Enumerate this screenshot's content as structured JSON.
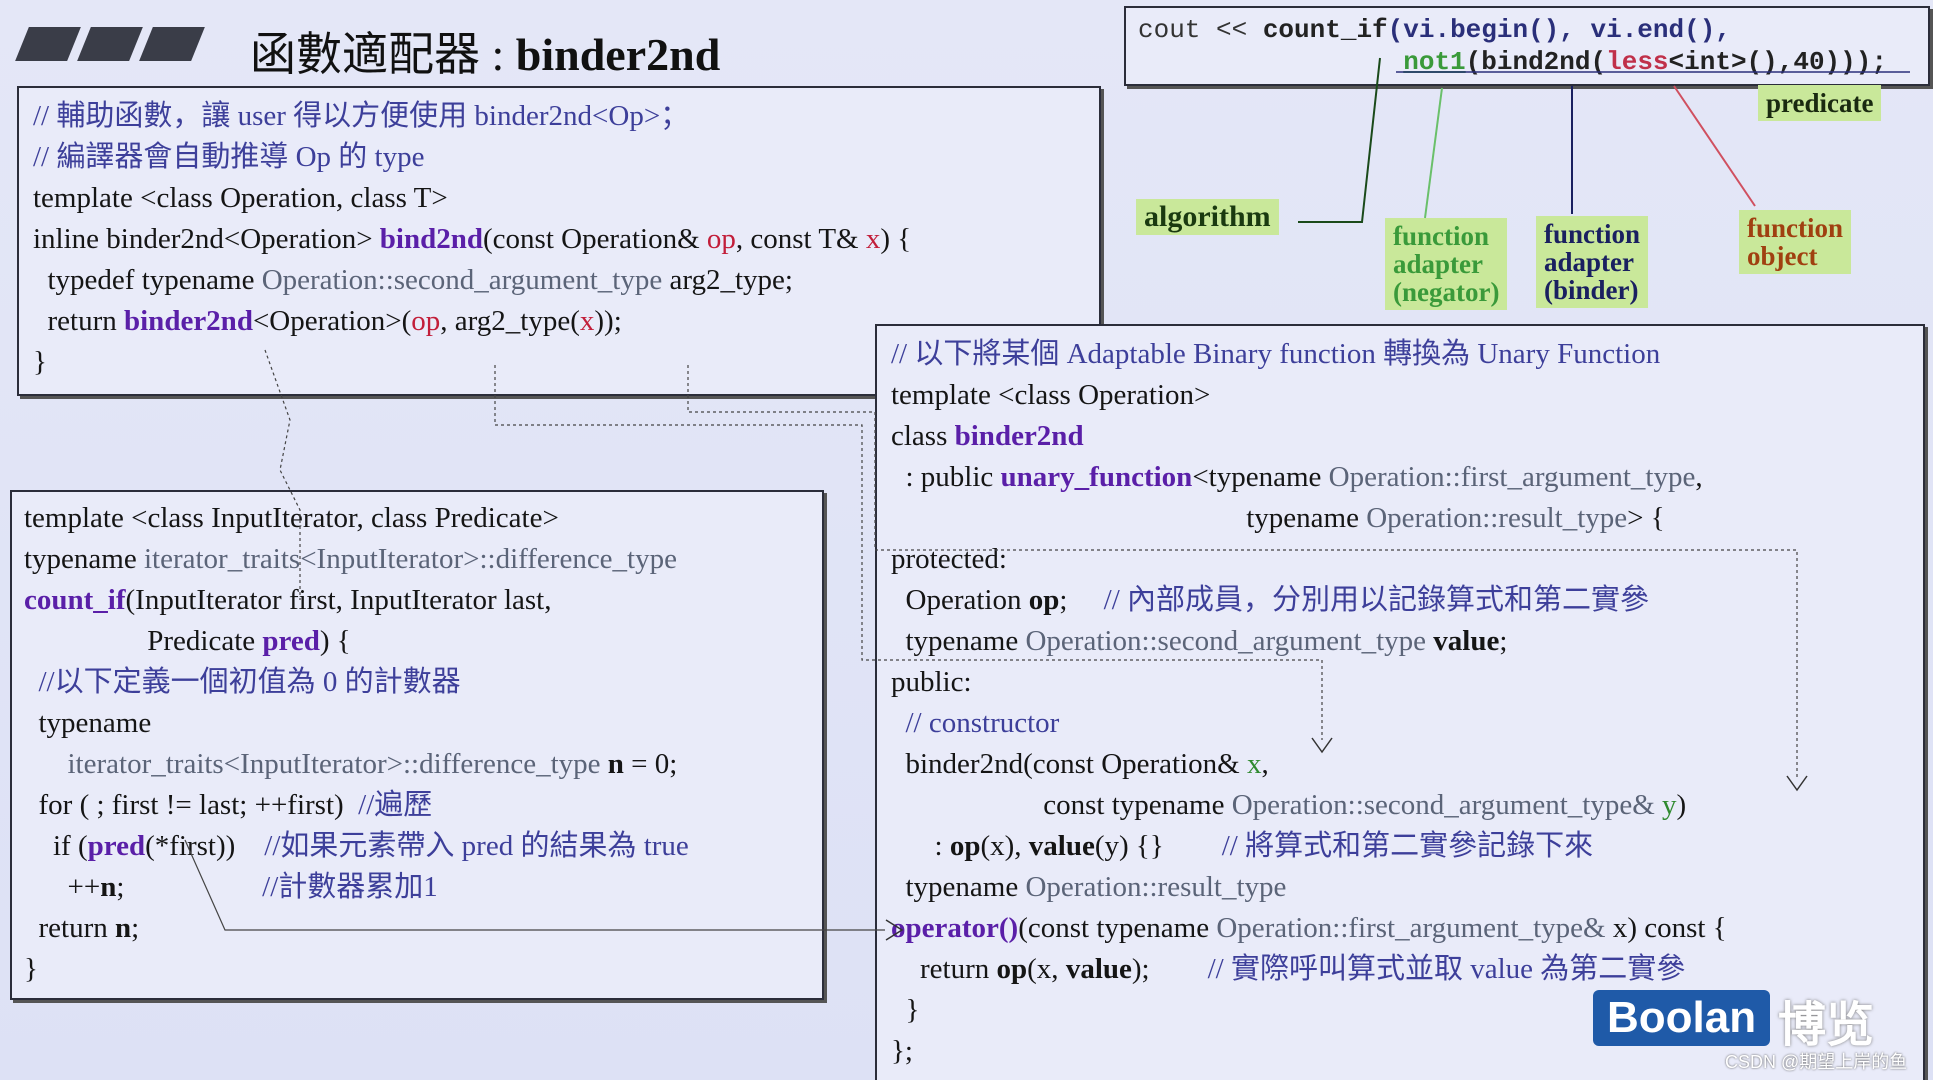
{
  "title": {
    "cn": "函數適配器 : ",
    "en": "binder2nd"
  },
  "top_code": [
    [
      {
        "t": "cout << ",
        "c": "m-plain"
      },
      {
        "t": "count_if",
        "c": "m-dark"
      },
      {
        "t": "(vi.begin(), vi.end(),",
        "c": "m-blue"
      }
    ],
    [
      {
        "t": "                 ",
        "c": "m-plain"
      },
      {
        "t": "not1",
        "c": "m-green"
      },
      {
        "t": "(bind2nd(",
        "c": "m-dark"
      },
      {
        "t": "less",
        "c": "m-red"
      },
      {
        "t": "<int>(),40)));",
        "c": "m-dark"
      }
    ]
  ],
  "labels": {
    "predicate": "predicate",
    "algorithm": "algorithm",
    "negator": "function\nadapter\n(negator)",
    "binder": "function\nadapter\n(binder)",
    "function_object": "function\nobject"
  },
  "colors": {
    "negator": "#3a9a3a",
    "binder": "#1a2060",
    "function_object": "#a04010",
    "algorithm": "#1a3a10",
    "keyword": "#5a1fa8"
  },
  "box1": [
    [
      {
        "t": "// 輔助函數，讓 user 得以方便使用 binder2nd<Op>；",
        "c": "cm"
      }
    ],
    [
      {
        "t": "// 編譯器會自動推導 Op 的 type",
        "c": "cm"
      }
    ],
    [
      {
        "t": "template <class Operation, class T>",
        "c": ""
      }
    ],
    [
      {
        "t": "inline binder2nd<Operation> ",
        "c": ""
      },
      {
        "t": "bind2nd",
        "c": "kw"
      },
      {
        "t": "(const Operation& ",
        "c": ""
      },
      {
        "t": "op",
        "c": "red"
      },
      {
        "t": ", const T& ",
        "c": ""
      },
      {
        "t": "x",
        "c": "red"
      },
      {
        "t": ") {",
        "c": ""
      }
    ],
    [
      {
        "t": "  typedef typename ",
        "c": ""
      },
      {
        "t": "Operation::second_argument_type",
        "c": "gray"
      },
      {
        "t": " arg2_type;",
        "c": ""
      }
    ],
    [
      {
        "t": "  return ",
        "c": ""
      },
      {
        "t": "binder2nd",
        "c": "kw"
      },
      {
        "t": "<Operation>(",
        "c": ""
      },
      {
        "t": "op",
        "c": "red"
      },
      {
        "t": ", arg2_type(",
        "c": ""
      },
      {
        "t": "x",
        "c": "red"
      },
      {
        "t": "));",
        "c": ""
      }
    ],
    [
      {
        "t": "}",
        "c": ""
      }
    ]
  ],
  "box2": [
    [
      {
        "t": "template <class InputIterator, class Predicate>",
        "c": ""
      }
    ],
    [
      {
        "t": "typename ",
        "c": ""
      },
      {
        "t": "iterator_traits<InputIterator>::difference_type",
        "c": "gray"
      }
    ],
    [
      {
        "t": "count_if",
        "c": "kw"
      },
      {
        "t": "(InputIterator first, InputIterator last,",
        "c": ""
      }
    ],
    [
      {
        "t": "                 Predicate ",
        "c": ""
      },
      {
        "t": "pred",
        "c": "kw"
      },
      {
        "t": ") {",
        "c": ""
      }
    ],
    [
      {
        "t": "  //以下定義一個初值為 0 的計數器",
        "c": "cm"
      }
    ],
    [
      {
        "t": "  typename",
        "c": ""
      }
    ],
    [
      {
        "t": "      ",
        "c": ""
      },
      {
        "t": "iterator_traits<InputIterator>::difference_type ",
        "c": "gray"
      },
      {
        "t": "n",
        "c": "bold"
      },
      {
        "t": " = 0;",
        "c": ""
      }
    ],
    [
      {
        "t": "  for ( ; first != last; ++first)  ",
        "c": ""
      },
      {
        "t": "//遍歷",
        "c": "cm"
      }
    ],
    [
      {
        "t": "    if (",
        "c": ""
      },
      {
        "t": "pred",
        "c": "kw"
      },
      {
        "t": "(*first))    ",
        "c": ""
      },
      {
        "t": "//如果元素帶入 pred 的結果為 true",
        "c": "cm"
      }
    ],
    [
      {
        "t": "      ++",
        "c": ""
      },
      {
        "t": "n",
        "c": "bold"
      },
      {
        "t": ";                   ",
        "c": ""
      },
      {
        "t": "//計數器累加1",
        "c": "cm"
      }
    ],
    [
      {
        "t": "  return ",
        "c": ""
      },
      {
        "t": "n",
        "c": "bold"
      },
      {
        "t": ";",
        "c": ""
      }
    ],
    [
      {
        "t": "}",
        "c": ""
      }
    ]
  ],
  "box3": [
    [
      {
        "t": "// 以下將某個 Adaptable Binary function 轉換為 Unary Function",
        "c": "cm"
      }
    ],
    [
      {
        "t": "template <class Operation>",
        "c": ""
      }
    ],
    [
      {
        "t": "class ",
        "c": ""
      },
      {
        "t": "binder2nd",
        "c": "kw"
      }
    ],
    [
      {
        "t": "  : public ",
        "c": ""
      },
      {
        "t": "unary_function",
        "c": "kw"
      },
      {
        "t": "<typename ",
        "c": ""
      },
      {
        "t": "Operation::first_argument_type",
        "c": "gray"
      },
      {
        "t": ",",
        "c": ""
      }
    ],
    [
      {
        "t": "                                                 typename ",
        "c": ""
      },
      {
        "t": "Operation::result_type",
        "c": "gray"
      },
      {
        "t": "> {",
        "c": ""
      }
    ],
    [
      {
        "t": "protected:",
        "c": ""
      }
    ],
    [
      {
        "t": "  Operation ",
        "c": ""
      },
      {
        "t": "op",
        "c": "bold"
      },
      {
        "t": ";     ",
        "c": ""
      },
      {
        "t": "// 內部成員，分別用以記錄算式和第二實參",
        "c": "cm"
      }
    ],
    [
      {
        "t": "  typename ",
        "c": ""
      },
      {
        "t": "Operation::second_argument_type ",
        "c": "gray"
      },
      {
        "t": "value",
        "c": "bold"
      },
      {
        "t": ";",
        "c": ""
      }
    ],
    [
      {
        "t": "public:",
        "c": ""
      }
    ],
    [
      {
        "t": "  // constructor",
        "c": "cm"
      }
    ],
    [
      {
        "t": "  binder2nd(const Operation& ",
        "c": ""
      },
      {
        "t": "x",
        "c": "green"
      },
      {
        "t": ",",
        "c": ""
      }
    ],
    [
      {
        "t": "                     const typename ",
        "c": ""
      },
      {
        "t": "Operation::second_argument_type&",
        "c": "gray"
      },
      {
        "t": " ",
        "c": ""
      },
      {
        "t": "y",
        "c": "green"
      },
      {
        "t": ")",
        "c": ""
      }
    ],
    [
      {
        "t": "      : ",
        "c": ""
      },
      {
        "t": "op",
        "c": "bold"
      },
      {
        "t": "(x), ",
        "c": ""
      },
      {
        "t": "value",
        "c": "bold"
      },
      {
        "t": "(y) {}        ",
        "c": ""
      },
      {
        "t": "// 將算式和第二實參記錄下來",
        "c": "cm"
      }
    ],
    [
      {
        "t": "  typename ",
        "c": ""
      },
      {
        "t": "Operation::result_type",
        "c": "gray"
      }
    ],
    [
      {
        "t": "operator()",
        "c": "kw"
      },
      {
        "t": "(const typename ",
        "c": ""
      },
      {
        "t": "Operation::first_argument_type&",
        "c": "gray"
      },
      {
        "t": " x) const {",
        "c": ""
      }
    ],
    [
      {
        "t": "    return ",
        "c": ""
      },
      {
        "t": "op",
        "c": "bold"
      },
      {
        "t": "(x, ",
        "c": ""
      },
      {
        "t": "value",
        "c": "bold"
      },
      {
        "t": ");        ",
        "c": ""
      },
      {
        "t": "// 實際呼叫算式並取 value 為第二實參",
        "c": "cm"
      }
    ],
    [
      {
        "t": "  }",
        "c": ""
      }
    ],
    [
      {
        "t": "};",
        "c": ""
      }
    ]
  ],
  "logo": {
    "brand": "Boolan",
    "cn": "博览"
  },
  "watermark": "CSDN @期望上岸的鱼"
}
